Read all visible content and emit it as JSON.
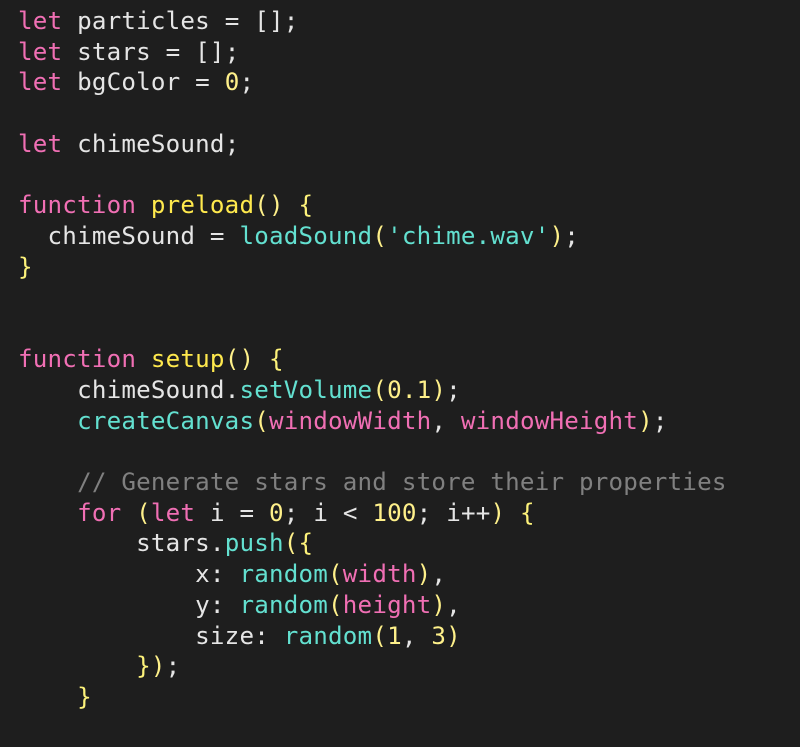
{
  "code": {
    "kw_let": "let",
    "kw_function": "function",
    "kw_for": "for",
    "id_particles": "particles",
    "id_stars": "stars",
    "id_bgColor": "bgColor",
    "id_chimeSound": "chimeSound",
    "id_i": "i",
    "fn_preload": "preload",
    "fn_setup": "setup",
    "call_loadSound": "loadSound",
    "call_setVolume": "setVolume",
    "call_createCanvas": "createCanvas",
    "call_push": "push",
    "call_random": "random",
    "global_windowWidth": "windowWidth",
    "global_windowHeight": "windowHeight",
    "global_width": "width",
    "global_height": "height",
    "str_chime": "'chime.wav'",
    "cmnt_stars": "// Generate stars and store their properties",
    "num_empty_arr": "[]",
    "num_0": "0",
    "num_0_1": "0.1",
    "num_100": "100",
    "num_1": "1",
    "num_3": "3",
    "prop_x": "x",
    "prop_y": "y",
    "prop_size": "size",
    "op_eq": "=",
    "op_semi": ";",
    "op_lt": "<",
    "op_inc": "++",
    "op_dot": ".",
    "op_comma": ",",
    "op_colon": ":",
    "paren_o": "(",
    "paren_c": ")",
    "brace_o": "{",
    "brace_c": "}"
  }
}
